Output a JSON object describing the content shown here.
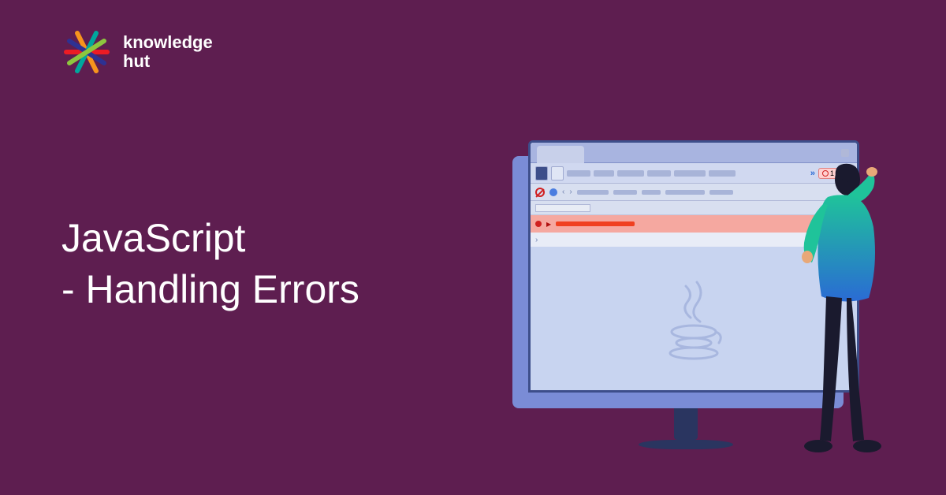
{
  "logo": {
    "line1": "knowledge",
    "line2": "hut"
  },
  "title": {
    "line1": "JavaScript",
    "line2": "- Handling Errors"
  },
  "devtools": {
    "error_count": "1",
    "chevron_label": "»"
  },
  "colors": {
    "background": "#5e1e50",
    "text": "#ffffff",
    "monitor_frame": "#3d4e8a",
    "error_bg": "#f5a8a0",
    "error_fg": "#f04020"
  }
}
